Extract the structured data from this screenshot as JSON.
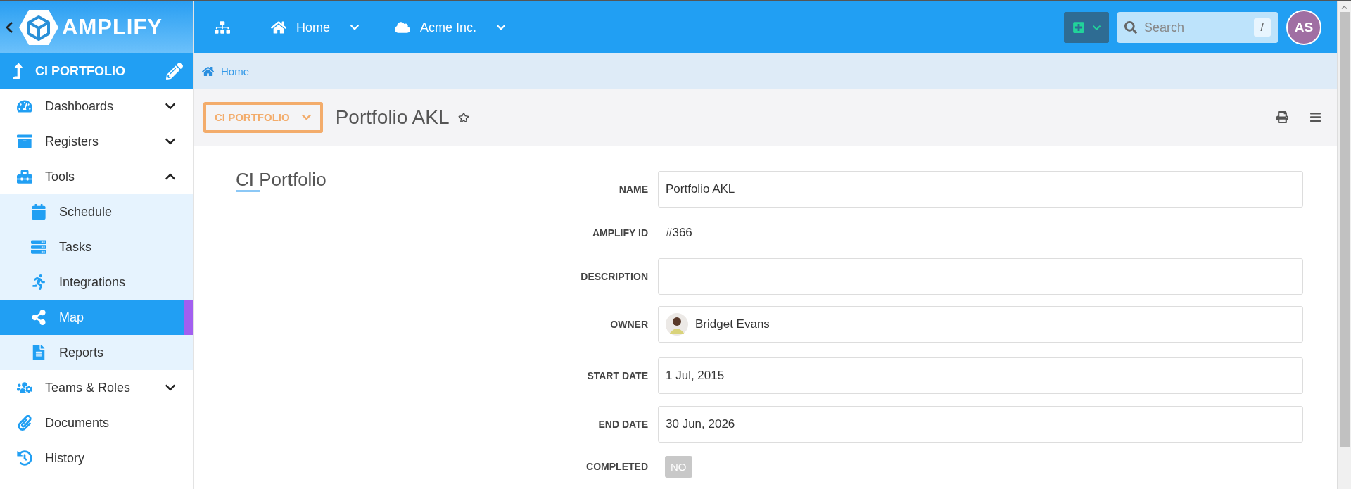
{
  "sidebar": {
    "logo": "AMPLIFY",
    "section": "CI PORTFOLIO",
    "items": [
      {
        "label": "Dashboards",
        "expanded": false,
        "selected": false
      },
      {
        "label": "Registers",
        "expanded": false,
        "selected": false
      },
      {
        "label": "Tools",
        "expanded": true,
        "selected": false,
        "children": [
          {
            "label": "Schedule",
            "selected": false
          },
          {
            "label": "Tasks",
            "selected": false
          },
          {
            "label": "Integrations",
            "selected": false
          },
          {
            "label": "Map",
            "selected": true
          },
          {
            "label": "Reports",
            "selected": false
          }
        ]
      },
      {
        "label": "Teams & Roles",
        "expanded": false,
        "selected": false
      },
      {
        "label": "Documents",
        "selected": false
      },
      {
        "label": "History",
        "selected": false
      }
    ]
  },
  "topbar": {
    "nav": [
      "Home",
      "Acme Inc."
    ],
    "search": {
      "placeholder": "Search",
      "shortcut": "/"
    },
    "user": "AS"
  },
  "breadcrumb": [
    "Home"
  ],
  "header": {
    "type": "CI PORTFOLIO",
    "title": "Portfolio AKL",
    "starred": false
  },
  "form": {
    "title": "CI Portfolio",
    "fields": [
      {
        "label": "NAME",
        "kind": "input",
        "value": "Portfolio AKL"
      },
      {
        "label": "AMPLIFY ID",
        "kind": "text",
        "value": "#366"
      },
      {
        "label": "DESCRIPTION",
        "kind": "input"
      },
      {
        "label": "OWNER",
        "kind": "person",
        "value": "Bridget Evans"
      },
      {
        "label": "START DATE",
        "kind": "input",
        "value": "1 Jul, 2015"
      },
      {
        "label": "END DATE",
        "kind": "input",
        "value": "30 Jun, 2026"
      },
      {
        "label": "COMPLETED",
        "kind": "toggle",
        "on": false,
        "value": "NO"
      }
    ]
  }
}
